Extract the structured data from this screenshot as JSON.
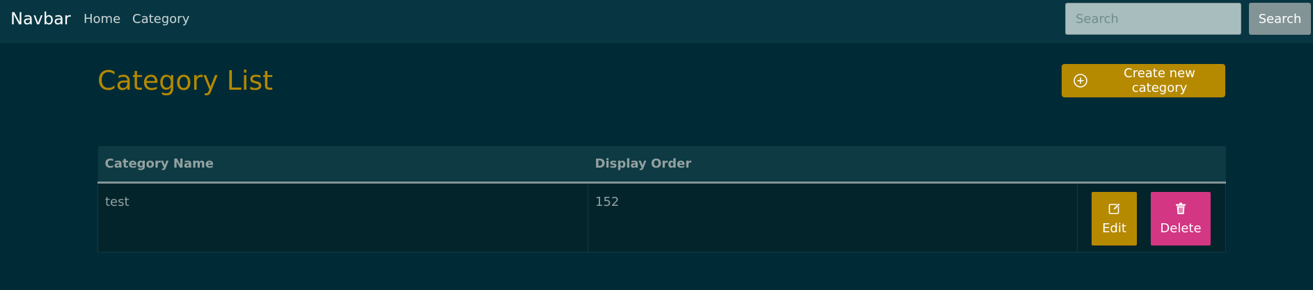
{
  "navbar": {
    "brand": "Navbar",
    "links": [
      {
        "label": "Home"
      },
      {
        "label": "Category"
      }
    ],
    "search": {
      "placeholder": "Search",
      "value": "",
      "button_label": "Search"
    }
  },
  "main": {
    "title": "Category List",
    "create_button_label": "Create new category",
    "create_icon": "plus-circle-icon"
  },
  "table": {
    "headers": [
      "Category Name",
      "Display Order",
      ""
    ],
    "rows": [
      {
        "name": "test",
        "display_order": "152",
        "edit_label": "Edit",
        "edit_icon": "edit-icon",
        "delete_label": "Delete",
        "delete_icon": "trash-icon"
      }
    ]
  },
  "colors": {
    "background": "#002b36",
    "navbar": "#073642",
    "accent": "#b58900",
    "danger": "#d33682",
    "text_muted": "#93a1a1"
  }
}
